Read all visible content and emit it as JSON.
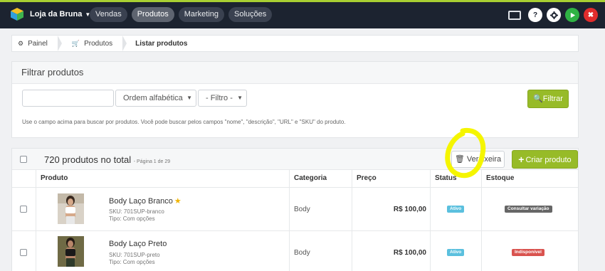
{
  "header": {
    "brand": "Loja da Bruna",
    "nav": [
      "Vendas",
      "Produtos",
      "Marketing",
      "Soluções"
    ],
    "help_label": "?",
    "close_label": "✖"
  },
  "breadcrumb": {
    "home": "Painel",
    "products": "Produtos",
    "current": "Listar produtos"
  },
  "filter": {
    "title": "Filtrar produtos",
    "search_value": "",
    "order_select": "Ordem alfabética",
    "filter_select": "- Filtro -",
    "filter_button": "Filtrar",
    "hint": "Use o campo acima para buscar por produtos. Você pode buscar pelos campos \"nome\", \"descrição\", \"URL\" e \"SKU\" do produto."
  },
  "products": {
    "count_text": "720 produtos no total",
    "page_text": "- Página 1 de 29",
    "trash_button": "Ver lixeira",
    "create_button": "Criar produto",
    "columns": [
      "Produto",
      "Categoria",
      "Preço",
      "Status",
      "Estoque"
    ],
    "rows": [
      {
        "name": "Body Laço Branco",
        "featured": true,
        "sku": "SKU: 701SUP-branco",
        "type": "Tipo: Com opções",
        "category": "Body",
        "price": "R$ 100,00",
        "status": "Ativo",
        "stock": "Consultar variação"
      },
      {
        "name": "Body Laço Preto",
        "featured": false,
        "sku": "SKU: 701SUP-preto",
        "type": "Tipo: Com opções",
        "category": "Body",
        "price": "R$ 100,00",
        "status": "Ativo",
        "stock": "Indisponível"
      }
    ]
  },
  "colors": {
    "topbar": "#1c2330",
    "accent_green": "#97bb28",
    "status_active": "#5bc0de",
    "stock_consult": "#666666",
    "stock_unavailable": "#d9534f",
    "highlight": "#f5f500"
  }
}
